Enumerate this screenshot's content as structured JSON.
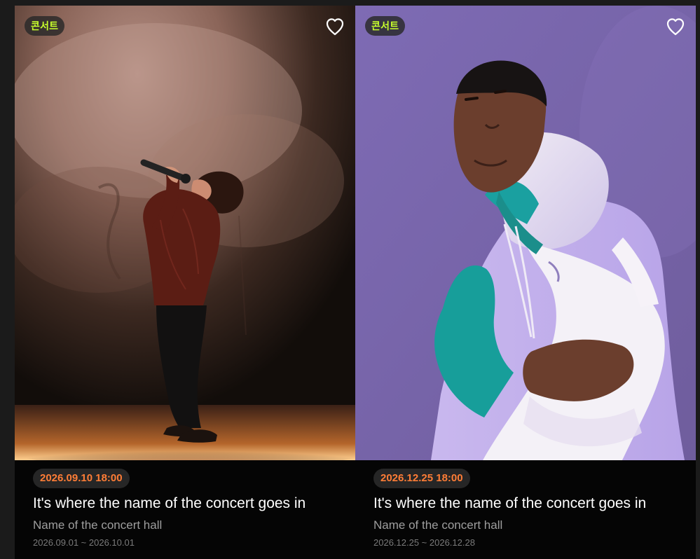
{
  "cards": [
    {
      "genre": "콘서트",
      "datetime": "2026.09.10 18:00",
      "title": "It's where the name of the concert goes in",
      "venue": "Name of the concert hall",
      "period": "2026.09.01 ~ 2026.10.01",
      "favorite": false,
      "image_subject": "singer-on-stage"
    },
    {
      "genre": "콘서트",
      "datetime": "2026.12.25 18:00",
      "title": "It's where the name of the concert goes in",
      "venue": "Name of the concert hall",
      "period": "2026.12.25 ~ 2026.12.28",
      "favorite": false,
      "image_subject": "artist-portrait"
    }
  ],
  "colors": {
    "genre_text": "#c7ff2c",
    "date_text": "#ff7d36",
    "card_background": "#050505"
  }
}
